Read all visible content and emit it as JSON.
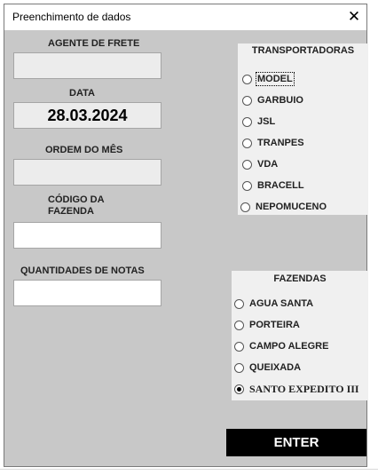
{
  "window": {
    "title": "Preenchimento de dados",
    "close_glyph": "✕"
  },
  "fields": {
    "agente_label": "AGENTE DE FRETE",
    "agente_value": "",
    "data_label": "DATA",
    "data_value": "28.03.2024",
    "ordem_label": "ORDEM DO MÊS",
    "ordem_value": "",
    "codigo_label_1": "CÓDIGO DA",
    "codigo_label_2": "FAZENDA",
    "codigo_value": "",
    "quantidades_label": "QUANTIDADES DE NOTAS",
    "quantidades_value": ""
  },
  "transportadoras": {
    "title": "TRANSPORTADORAS",
    "options": [
      "MODEL",
      "GARBUIO",
      "JSL",
      "TRANPES",
      "VDA",
      "BRACELL",
      "NEPOMUCENO"
    ],
    "selected": null,
    "focused": "MODEL"
  },
  "fazendas": {
    "title": "FAZENDAS",
    "options": [
      "AGUA SANTA",
      "PORTEIRA",
      "CAMPO ALEGRE",
      "QUEIXADA",
      "SANTO EXPEDITO III"
    ],
    "selected": "SANTO EXPEDITO III"
  },
  "enter_label": "ENTER",
  "colors": {
    "form_bg": "#c8c8c8",
    "group_bg": "#f0f0f0",
    "button_bg": "#000000",
    "button_text": "#ffffff"
  }
}
